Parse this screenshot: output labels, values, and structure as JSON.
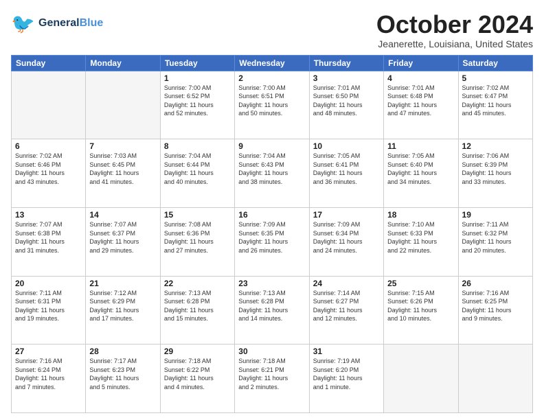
{
  "header": {
    "logo_general": "General",
    "logo_blue": "Blue",
    "month_title": "October 2024",
    "location": "Jeanerette, Louisiana, United States"
  },
  "weekdays": [
    "Sunday",
    "Monday",
    "Tuesday",
    "Wednesday",
    "Thursday",
    "Friday",
    "Saturday"
  ],
  "weeks": [
    [
      {
        "day": "",
        "info": ""
      },
      {
        "day": "",
        "info": ""
      },
      {
        "day": "1",
        "info": "Sunrise: 7:00 AM\nSunset: 6:52 PM\nDaylight: 11 hours\nand 52 minutes."
      },
      {
        "day": "2",
        "info": "Sunrise: 7:00 AM\nSunset: 6:51 PM\nDaylight: 11 hours\nand 50 minutes."
      },
      {
        "day": "3",
        "info": "Sunrise: 7:01 AM\nSunset: 6:50 PM\nDaylight: 11 hours\nand 48 minutes."
      },
      {
        "day": "4",
        "info": "Sunrise: 7:01 AM\nSunset: 6:48 PM\nDaylight: 11 hours\nand 47 minutes."
      },
      {
        "day": "5",
        "info": "Sunrise: 7:02 AM\nSunset: 6:47 PM\nDaylight: 11 hours\nand 45 minutes."
      }
    ],
    [
      {
        "day": "6",
        "info": "Sunrise: 7:02 AM\nSunset: 6:46 PM\nDaylight: 11 hours\nand 43 minutes."
      },
      {
        "day": "7",
        "info": "Sunrise: 7:03 AM\nSunset: 6:45 PM\nDaylight: 11 hours\nand 41 minutes."
      },
      {
        "day": "8",
        "info": "Sunrise: 7:04 AM\nSunset: 6:44 PM\nDaylight: 11 hours\nand 40 minutes."
      },
      {
        "day": "9",
        "info": "Sunrise: 7:04 AM\nSunset: 6:43 PM\nDaylight: 11 hours\nand 38 minutes."
      },
      {
        "day": "10",
        "info": "Sunrise: 7:05 AM\nSunset: 6:41 PM\nDaylight: 11 hours\nand 36 minutes."
      },
      {
        "day": "11",
        "info": "Sunrise: 7:05 AM\nSunset: 6:40 PM\nDaylight: 11 hours\nand 34 minutes."
      },
      {
        "day": "12",
        "info": "Sunrise: 7:06 AM\nSunset: 6:39 PM\nDaylight: 11 hours\nand 33 minutes."
      }
    ],
    [
      {
        "day": "13",
        "info": "Sunrise: 7:07 AM\nSunset: 6:38 PM\nDaylight: 11 hours\nand 31 minutes."
      },
      {
        "day": "14",
        "info": "Sunrise: 7:07 AM\nSunset: 6:37 PM\nDaylight: 11 hours\nand 29 minutes."
      },
      {
        "day": "15",
        "info": "Sunrise: 7:08 AM\nSunset: 6:36 PM\nDaylight: 11 hours\nand 27 minutes."
      },
      {
        "day": "16",
        "info": "Sunrise: 7:09 AM\nSunset: 6:35 PM\nDaylight: 11 hours\nand 26 minutes."
      },
      {
        "day": "17",
        "info": "Sunrise: 7:09 AM\nSunset: 6:34 PM\nDaylight: 11 hours\nand 24 minutes."
      },
      {
        "day": "18",
        "info": "Sunrise: 7:10 AM\nSunset: 6:33 PM\nDaylight: 11 hours\nand 22 minutes."
      },
      {
        "day": "19",
        "info": "Sunrise: 7:11 AM\nSunset: 6:32 PM\nDaylight: 11 hours\nand 20 minutes."
      }
    ],
    [
      {
        "day": "20",
        "info": "Sunrise: 7:11 AM\nSunset: 6:31 PM\nDaylight: 11 hours\nand 19 minutes."
      },
      {
        "day": "21",
        "info": "Sunrise: 7:12 AM\nSunset: 6:29 PM\nDaylight: 11 hours\nand 17 minutes."
      },
      {
        "day": "22",
        "info": "Sunrise: 7:13 AM\nSunset: 6:28 PM\nDaylight: 11 hours\nand 15 minutes."
      },
      {
        "day": "23",
        "info": "Sunrise: 7:13 AM\nSunset: 6:28 PM\nDaylight: 11 hours\nand 14 minutes."
      },
      {
        "day": "24",
        "info": "Sunrise: 7:14 AM\nSunset: 6:27 PM\nDaylight: 11 hours\nand 12 minutes."
      },
      {
        "day": "25",
        "info": "Sunrise: 7:15 AM\nSunset: 6:26 PM\nDaylight: 11 hours\nand 10 minutes."
      },
      {
        "day": "26",
        "info": "Sunrise: 7:16 AM\nSunset: 6:25 PM\nDaylight: 11 hours\nand 9 minutes."
      }
    ],
    [
      {
        "day": "27",
        "info": "Sunrise: 7:16 AM\nSunset: 6:24 PM\nDaylight: 11 hours\nand 7 minutes."
      },
      {
        "day": "28",
        "info": "Sunrise: 7:17 AM\nSunset: 6:23 PM\nDaylight: 11 hours\nand 5 minutes."
      },
      {
        "day": "29",
        "info": "Sunrise: 7:18 AM\nSunset: 6:22 PM\nDaylight: 11 hours\nand 4 minutes."
      },
      {
        "day": "30",
        "info": "Sunrise: 7:18 AM\nSunset: 6:21 PM\nDaylight: 11 hours\nand 2 minutes."
      },
      {
        "day": "31",
        "info": "Sunrise: 7:19 AM\nSunset: 6:20 PM\nDaylight: 11 hours\nand 1 minute."
      },
      {
        "day": "",
        "info": ""
      },
      {
        "day": "",
        "info": ""
      }
    ]
  ]
}
